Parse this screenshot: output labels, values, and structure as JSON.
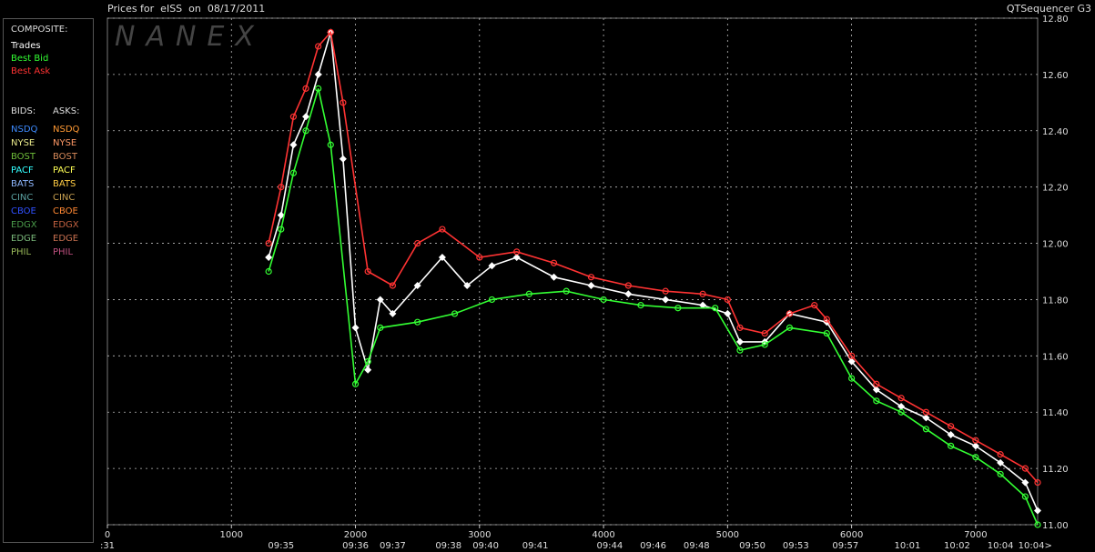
{
  "header": {
    "title": "Prices for  eISS  on  08/17/2011",
    "app": "QTSequencer G3",
    "watermark": "NANEX"
  },
  "legend": {
    "composite_heading": "COMPOSITE:",
    "composite": [
      {
        "label": "Trades",
        "color": "#ffffff"
      },
      {
        "label": "Best Bid",
        "color": "#33ff33"
      },
      {
        "label": "Best Ask",
        "color": "#ff3333"
      }
    ],
    "bids_heading": "BIDS:",
    "asks_heading": "ASKS:",
    "bids": [
      {
        "label": "NSDQ",
        "color": "#3d8bff"
      },
      {
        "label": "NYSE",
        "color": "#e8e88a"
      },
      {
        "label": "BOST",
        "color": "#6fbf3a"
      },
      {
        "label": "PACF",
        "color": "#33ffff"
      },
      {
        "label": "BATS",
        "color": "#8fb8ff"
      },
      {
        "label": "CINC",
        "color": "#5aa0a0"
      },
      {
        "label": "CBOE",
        "color": "#3050ff"
      },
      {
        "label": "EDGX",
        "color": "#4a9a4a"
      },
      {
        "label": "EDGE",
        "color": "#7ab87a"
      },
      {
        "label": "PHIL",
        "color": "#9aba5a"
      }
    ],
    "asks": [
      {
        "label": "NSDQ",
        "color": "#ff9933"
      },
      {
        "label": "NYSE",
        "color": "#ff9966"
      },
      {
        "label": "BOST",
        "color": "#d88a5a"
      },
      {
        "label": "PACF",
        "color": "#ffff55"
      },
      {
        "label": "BATS",
        "color": "#ffcc44"
      },
      {
        "label": "CINC",
        "color": "#c8a050"
      },
      {
        "label": "CBOE",
        "color": "#ff8833"
      },
      {
        "label": "EDGX",
        "color": "#c06040"
      },
      {
        "label": "EDGE",
        "color": "#c87050"
      },
      {
        "label": "PHIL",
        "color": "#c05080"
      }
    ]
  },
  "chart_data": {
    "type": "line",
    "xlim": [
      0,
      7500
    ],
    "ylim": [
      11.0,
      12.8
    ],
    "x_ticks": [
      0,
      1000,
      2000,
      3000,
      4000,
      5000,
      6000,
      7000
    ],
    "y_ticks": [
      "11.00",
      "11.20",
      "11.40",
      "11.60",
      "11.80",
      "12.00",
      "12.20",
      "12.40",
      "12.60",
      "12.80"
    ],
    "time_labels": [
      {
        "x": 0,
        "label": ":31"
      },
      {
        "x": 1400,
        "label": "09:35"
      },
      {
        "x": 2000,
        "label": "09:36"
      },
      {
        "x": 2300,
        "label": "09:37"
      },
      {
        "x": 2750,
        "label": "09:38"
      },
      {
        "x": 3050,
        "label": "09:40"
      },
      {
        "x": 3450,
        "label": "09:41"
      },
      {
        "x": 4050,
        "label": "09:44"
      },
      {
        "x": 4400,
        "label": "09:46"
      },
      {
        "x": 4750,
        "label": "09:48"
      },
      {
        "x": 5200,
        "label": "09:50"
      },
      {
        "x": 5550,
        "label": "09:53"
      },
      {
        "x": 5950,
        "label": "09:57"
      },
      {
        "x": 6450,
        "label": "10:01"
      },
      {
        "x": 6850,
        "label": "10:02"
      },
      {
        "x": 7200,
        "label": "10:04"
      },
      {
        "x": 7480,
        "label": "10:04>"
      }
    ],
    "series": [
      {
        "name": "Trades",
        "color": "#ffffff",
        "x": [
          1300,
          1400,
          1500,
          1600,
          1700,
          1800,
          1900,
          2000,
          2100,
          2200,
          2300,
          2500,
          2700,
          2900,
          3100,
          3300,
          3600,
          3900,
          4200,
          4500,
          4800,
          5000,
          5100,
          5300,
          5500,
          5800,
          6000,
          6200,
          6400,
          6600,
          6800,
          7000,
          7200,
          7400,
          7500
        ],
        "y": [
          11.95,
          12.1,
          12.35,
          12.45,
          12.6,
          12.75,
          12.3,
          11.7,
          11.55,
          11.8,
          11.75,
          11.85,
          11.95,
          11.85,
          11.92,
          11.95,
          11.88,
          11.85,
          11.82,
          11.8,
          11.78,
          11.75,
          11.65,
          11.65,
          11.75,
          11.72,
          11.58,
          11.48,
          11.42,
          11.38,
          11.32,
          11.28,
          11.22,
          11.15,
          11.05
        ]
      },
      {
        "name": "Best Bid",
        "color": "#33ff33",
        "x": [
          1300,
          1400,
          1500,
          1600,
          1700,
          1800,
          2000,
          2100,
          2200,
          2500,
          2800,
          3100,
          3400,
          3700,
          4000,
          4300,
          4600,
          4900,
          5100,
          5300,
          5500,
          5800,
          6000,
          6200,
          6400,
          6600,
          6800,
          7000,
          7200,
          7400,
          7500
        ],
        "y": [
          11.9,
          12.05,
          12.25,
          12.4,
          12.55,
          12.35,
          11.5,
          11.58,
          11.7,
          11.72,
          11.75,
          11.8,
          11.82,
          11.83,
          11.8,
          11.78,
          11.77,
          11.77,
          11.62,
          11.64,
          11.7,
          11.68,
          11.52,
          11.44,
          11.4,
          11.34,
          11.28,
          11.24,
          11.18,
          11.1,
          11.0
        ]
      },
      {
        "name": "Best Ask",
        "color": "#ff3333",
        "x": [
          1300,
          1400,
          1500,
          1600,
          1700,
          1800,
          1900,
          2100,
          2300,
          2500,
          2700,
          3000,
          3300,
          3600,
          3900,
          4200,
          4500,
          4800,
          5000,
          5100,
          5300,
          5500,
          5700,
          5800,
          6000,
          6200,
          6400,
          6600,
          6800,
          7000,
          7200,
          7400,
          7500
        ],
        "y": [
          12.0,
          12.2,
          12.45,
          12.55,
          12.7,
          12.75,
          12.5,
          11.9,
          11.85,
          12.0,
          12.05,
          11.95,
          11.97,
          11.93,
          11.88,
          11.85,
          11.83,
          11.82,
          11.8,
          11.7,
          11.68,
          11.75,
          11.78,
          11.73,
          11.6,
          11.5,
          11.45,
          11.4,
          11.35,
          11.3,
          11.25,
          11.2,
          11.15
        ]
      }
    ]
  }
}
